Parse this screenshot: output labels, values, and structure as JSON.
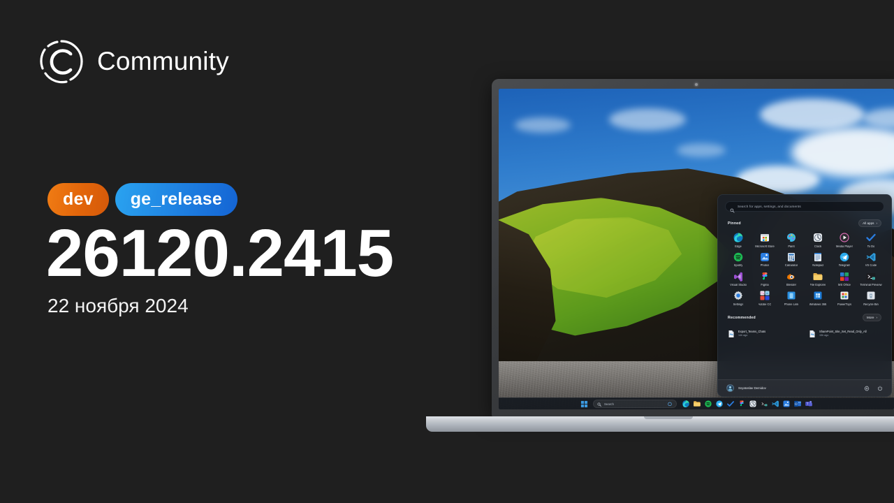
{
  "brand": {
    "name": "Community",
    "logo_icon": "community-circle-logo"
  },
  "release": {
    "badges": [
      {
        "label": "dev",
        "color": "#e2650a"
      },
      {
        "label": "ge_release",
        "color": "#1e7fe0"
      }
    ],
    "build_number": "26120.2415",
    "date": "22 ноября 2024"
  },
  "start_menu": {
    "search": {
      "placeholder": "Search for apps, settings, and documents",
      "icon": "search-icon"
    },
    "pinned": {
      "title": "Pinned",
      "all_apps_label": "All apps",
      "all_apps_chevron": "›",
      "apps": [
        {
          "label": "Edge",
          "icon": "edge-icon"
        },
        {
          "label": "Microsoft Store",
          "icon": "microsoft-store-icon"
        },
        {
          "label": "Paint",
          "icon": "paint-icon"
        },
        {
          "label": "Clock",
          "icon": "clock-icon"
        },
        {
          "label": "Media Player",
          "icon": "media-player-icon"
        },
        {
          "label": "To Do",
          "icon": "to-do-icon"
        },
        {
          "label": "Spotify",
          "icon": "spotify-icon"
        },
        {
          "label": "Photos",
          "icon": "photos-icon"
        },
        {
          "label": "Calculator",
          "icon": "calculator-icon"
        },
        {
          "label": "Notepad",
          "icon": "notepad-icon"
        },
        {
          "label": "Telegram",
          "icon": "telegram-icon"
        },
        {
          "label": "VS Code",
          "icon": "vs-code-icon"
        },
        {
          "label": "Visual Studio",
          "icon": "visual-studio-icon"
        },
        {
          "label": "Figma",
          "icon": "figma-icon"
        },
        {
          "label": "Blender",
          "icon": "blender-icon"
        },
        {
          "label": "File Explorer",
          "icon": "file-explorer-icon"
        },
        {
          "label": "MS Office",
          "icon": "ms-office-icon"
        },
        {
          "label": "Terminal Preview",
          "icon": "terminal-preview-icon"
        },
        {
          "label": "Settings",
          "icon": "settings-gear-icon"
        },
        {
          "label": "Adobe CC",
          "icon": "adobe-cc-icon"
        },
        {
          "label": "Phone Link",
          "icon": "phone-link-icon"
        },
        {
          "label": "Windows 365",
          "icon": "windows-365-icon"
        },
        {
          "label": "PowerToys",
          "icon": "powertoys-icon"
        },
        {
          "label": "Recycle Bin",
          "icon": "recycle-bin-icon"
        }
      ]
    },
    "recommended": {
      "title": "Recommended",
      "more_label": "More",
      "more_chevron": "›",
      "items": [
        {
          "name": "Export_Teams_Chats",
          "time": "14h ago",
          "icon": "document-icon"
        },
        {
          "name": "SharePoint_Site_Set_Read_Only_All",
          "time": "15h ago",
          "icon": "document-icon"
        }
      ]
    },
    "footer": {
      "user_name": "Svyatoslav Demidov",
      "avatar_icon": "user-avatar",
      "settings_icon": "gear-icon",
      "power_icon": "power-icon"
    }
  },
  "taskbar": {
    "start_icon": "windows-start-icon",
    "search_placeholder": "Search",
    "search_icon": "search-icon",
    "copilot_icon": "copilot-icon",
    "apps": [
      {
        "icon": "edge-icon"
      },
      {
        "icon": "file-explorer-icon"
      },
      {
        "icon": "spotify-icon"
      },
      {
        "icon": "telegram-icon"
      },
      {
        "icon": "to-do-icon"
      },
      {
        "icon": "figma-icon"
      },
      {
        "icon": "clock-icon"
      },
      {
        "icon": "terminal-preview-icon"
      },
      {
        "icon": "vs-code-icon"
      },
      {
        "icon": "photos-icon"
      },
      {
        "icon": "outlook-icon"
      },
      {
        "icon": "teams-icon"
      }
    ]
  },
  "wallpaper": {
    "description": "Iceland mossy cliff and black pebble beach under blue sky"
  }
}
